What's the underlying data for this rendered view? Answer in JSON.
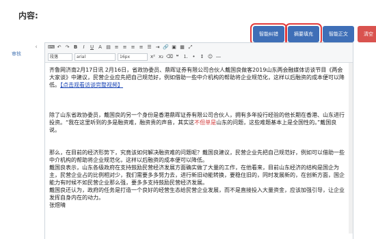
{
  "form": {
    "content_label": "内容:",
    "side_label": "审核"
  },
  "actions": [
    {
      "label": "智能纠错",
      "color": "#3f6fb7",
      "highlight": true
    },
    {
      "label": "摘要填充",
      "color": "#3f6fb7",
      "highlight": true
    },
    {
      "label": "智能正文",
      "color": "#3f6fb7",
      "highlight": false
    },
    {
      "label": "清空",
      "color": "#d9534f",
      "highlight": false
    }
  ],
  "toolbar": {
    "format_select": "段落",
    "font_select": "arial",
    "size_select": "16px",
    "icons": [
      "html-icon",
      "undo-icon",
      "redo-icon",
      "bold-icon",
      "italic-icon",
      "underline-icon",
      "font-color-icon",
      "highlight-icon",
      "align-left-icon",
      "align-center-icon",
      "align-right-icon",
      "align-justify-icon",
      "indent-icon",
      "link-icon",
      "image-icon",
      "table-icon",
      "fullscreen-icon"
    ]
  },
  "editor": {
    "p1": "齐鲁网济南2月17日讯 2月16日，省政协委员、鼎晖证券有限公司合伙人戴国良做客2019山东两会融媒体访谈节目《两会大家谈》中建议，民营企业应先把自己规范好，例如借助一些中介机构的帮助将企业规范化，这样以后融资的成本便可以降低。",
    "p1_link": "【点击观看访谈完整视频】",
    "p2a": "除了山东省政协委员，戴国良的另一个身份是香港鼎晖证券有限公司合伙人，拥有多年投行经验的他长期在香港、山东进行投资。“我在这里听到的多是融资难，融资贵的声音，其实这",
    "p2_red": "不但单是",
    "p2b": "山东的问题，这些难题基本上是全国性的。”戴国良说。",
    "p3": "那么，在目前的经济形势下，究竟该如何解决融资难的问题呢？戴国良建议，民营企业先把自己规范好，例如可以借助一些中介机构的帮助将企业规范化，这样以后融资的成本便可以降低。",
    "p4": "戴国良表示，山东各级政府在支持鼓励民营经济发展方面确实做了大量的工作，在他看来，目前山东经济的结构是国企为主，民营企业占的比例相对少，我们需要多多努力去，进行新旧动能转换，要稳住旧的，同时发展新的，在创新方面，国企能力有时候不如民营企业那么强，要多多支持鼓励民营经济发展。",
    "p5": "戴国良还认为，政府的任务是打造一个良好的经营生态给民营企业发展，而不是直接投入大量资金，应该加强引导，让企业发挥自身内在的动力。",
    "author": "张煜晴"
  }
}
